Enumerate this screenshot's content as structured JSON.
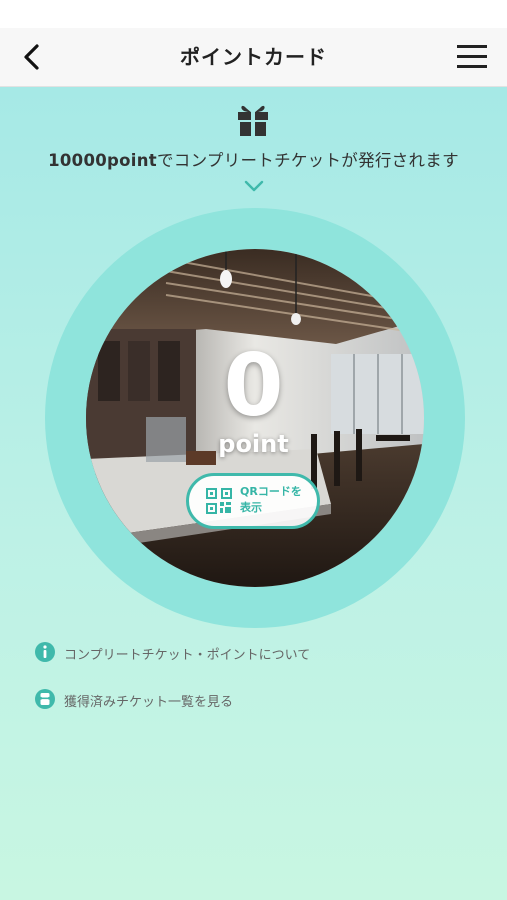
{
  "header": {
    "title": "ポイントカード",
    "back_icon": "chevron-left-icon",
    "menu_icon": "hamburger-menu-icon"
  },
  "banner": {
    "gift_icon": "gift-icon",
    "points_required": "10000point",
    "message": "でコンプリートチケットが発行されます",
    "chevron_icon": "chevron-down-icon"
  },
  "card": {
    "points": "0",
    "unit": "point",
    "qr_button": {
      "label_line1": "QRコードを",
      "label_line2": "表示",
      "icon": "qr-code-icon"
    }
  },
  "links": [
    {
      "label": "コンプリートチケット・ポイントについて",
      "icon": "info-icon"
    },
    {
      "label": "獲得済みチケット一覧を見る",
      "icon": "ticket-icon"
    }
  ],
  "colors": {
    "accent": "#3fb9ab",
    "ring": "#8fe4dc",
    "background_top": "#a6e9e6",
    "background_bottom": "#c8f6e2"
  }
}
